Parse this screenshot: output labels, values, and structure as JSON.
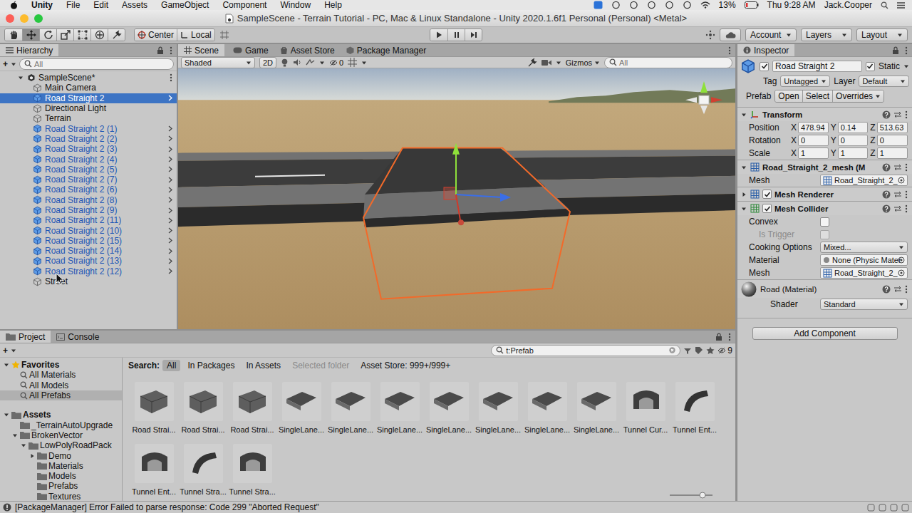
{
  "menubar": {
    "menus": [
      "Unity",
      "File",
      "Edit",
      "Assets",
      "GameObject",
      "Component",
      "Window",
      "Help"
    ],
    "battery": "13%",
    "clock": "Thu 9:28 AM",
    "user": "Jack.Cooper"
  },
  "window": {
    "title": "SampleScene - Terrain Tutorial - PC, Mac & Linux Standalone - Unity 2020.1.6f1 Personal (Personal) <Metal>"
  },
  "toolbar": {
    "tools": [
      {
        "selected": false
      },
      {
        "selected": true
      },
      {
        "selected": false
      },
      {
        "selected": false
      },
      {
        "selected": false
      },
      {
        "selected": false
      },
      {
        "selected": false
      }
    ],
    "pivot": "Center",
    "space": "Local",
    "account": "Account",
    "layers": "Layers",
    "layout": "Layout"
  },
  "hierarchy": {
    "title": "Hierarchy",
    "add": "+",
    "search": "All",
    "scene": "SampleScene*",
    "items": [
      {
        "label": "Main Camera",
        "kind": "object",
        "selected": false
      },
      {
        "label": "Road Straight 2",
        "kind": "prefab",
        "selected": true
      },
      {
        "label": "Directional Light",
        "kind": "object",
        "selected": false
      },
      {
        "label": "Terrain",
        "kind": "object",
        "selected": false
      },
      {
        "label": "Road Straight 2 (1)",
        "kind": "prefab",
        "selected": false
      },
      {
        "label": "Road Straight 2 (2)",
        "kind": "prefab",
        "selected": false
      },
      {
        "label": "Road Straight 2 (3)",
        "kind": "prefab",
        "selected": false
      },
      {
        "label": "Road Straight 2 (4)",
        "kind": "prefab",
        "selected": false
      },
      {
        "label": "Road Straight 2 (5)",
        "kind": "prefab",
        "selected": false
      },
      {
        "label": "Road Straight 2 (7)",
        "kind": "prefab",
        "selected": false
      },
      {
        "label": "Road Straight 2 (6)",
        "kind": "prefab",
        "selected": false
      },
      {
        "label": "Road Straight 2 (8)",
        "kind": "prefab",
        "selected": false
      },
      {
        "label": "Road Straight 2 (9)",
        "kind": "prefab",
        "selected": false
      },
      {
        "label": "Road Straight 2 (11)",
        "kind": "prefab",
        "selected": false
      },
      {
        "label": "Road Straight 2 (10)",
        "kind": "prefab",
        "selected": false
      },
      {
        "label": "Road Straight 2 (15)",
        "kind": "prefab",
        "selected": false
      },
      {
        "label": "Road Straight 2 (14)",
        "kind": "prefab",
        "selected": false
      },
      {
        "label": "Road Straight 2 (13)",
        "kind": "prefab",
        "selected": false
      },
      {
        "label": "Road Straight 2 (12)",
        "kind": "prefab",
        "selected": false
      },
      {
        "label": "Street",
        "kind": "object",
        "selected": false
      }
    ]
  },
  "scene_tabs": [
    {
      "label": "Scene",
      "selected": true
    },
    {
      "label": "Game",
      "selected": false
    },
    {
      "label": "Asset Store",
      "selected": false
    },
    {
      "label": "Package Manager",
      "selected": false
    }
  ],
  "scene_toolbar": {
    "shading": "Shaded",
    "mode": "2D",
    "hidden": "0",
    "gizmos": "Gizmos",
    "search": "All"
  },
  "inspector": {
    "title": "Inspector",
    "object": {
      "name": "Road Straight 2",
      "active": true,
      "static_label": "Static",
      "static": true,
      "tag_label": "Tag",
      "tag": "Untagged",
      "layer_label": "Layer",
      "layer": "Default",
      "prefab_label": "Prefab",
      "open": "Open",
      "select": "Select",
      "overrides": "Overrides"
    },
    "transform": {
      "title": "Transform",
      "expanded": true,
      "axes": [
        "X",
        "Y",
        "Z"
      ],
      "rows": [
        {
          "label": "Position",
          "x": "478.94",
          "y": "0.14",
          "z": "513.63"
        },
        {
          "label": "Rotation",
          "x": "0",
          "y": "0",
          "z": "0"
        },
        {
          "label": "Scale",
          "x": "1",
          "y": "1",
          "z": "1"
        }
      ]
    },
    "components": [
      {
        "kind": "plain",
        "expanded": true,
        "title": "Road_Straight_2_mesh (M",
        "fields": [
          {
            "kind": "object",
            "label": "Mesh",
            "value": "Road_Straight_2_"
          }
        ]
      },
      {
        "kind": "toggle",
        "expanded": false,
        "enabled": true,
        "title": "Mesh Renderer",
        "fields": []
      },
      {
        "kind": "toggle",
        "expanded": true,
        "enabled": true,
        "title": "Mesh Collider",
        "fields": [
          {
            "kind": "checkbox",
            "label": "Convex",
            "checked": false,
            "disabled": false
          },
          {
            "kind": "checkbox",
            "label": "Is Trigger",
            "checked": false,
            "disabled": true
          },
          {
            "kind": "dropdown",
            "label": "Cooking Options",
            "value": "Mixed..."
          },
          {
            "kind": "object",
            "label": "Material",
            "value": "None (Physic Mater"
          },
          {
            "kind": "object",
            "label": "Mesh",
            "value": "Road_Straight_2_"
          }
        ]
      }
    ],
    "material": {
      "name": "Road (Material)",
      "shader_label": "Shader",
      "shader": "Standard"
    },
    "add_component": "Add Component"
  },
  "project": {
    "tabs": [
      {
        "label": "Project",
        "selected": true
      },
      {
        "label": "Console",
        "selected": false
      }
    ],
    "add": "+",
    "search": "t:Prefab",
    "count": "9",
    "filter_label": "Search:",
    "filters": [
      {
        "label": "All",
        "selected": true,
        "disabled": false
      },
      {
        "label": "In Packages",
        "selected": false,
        "disabled": false
      },
      {
        "label": "In Assets",
        "selected": false,
        "disabled": false
      },
      {
        "label": "Selected folder",
        "selected": false,
        "disabled": true
      }
    ],
    "asset_store": "Asset Store: 999+/999+",
    "tree": [
      {
        "label": "Favorites",
        "kind": "favorites",
        "depth": 0,
        "arrow": "open",
        "selected": false
      },
      {
        "label": "All Materials",
        "kind": "search",
        "depth": 1,
        "arrow": "none",
        "selected": false
      },
      {
        "label": "All Models",
        "kind": "search",
        "depth": 1,
        "arrow": "none",
        "selected": false
      },
      {
        "label": "All Prefabs",
        "kind": "search",
        "depth": 1,
        "arrow": "none",
        "selected": true
      },
      {
        "label": "Assets",
        "kind": "root",
        "depth": 0,
        "arrow": "open",
        "selected": false
      },
      {
        "label": "_TerrainAutoUpgrade",
        "kind": "folder",
        "depth": 1,
        "arrow": "none",
        "selected": false
      },
      {
        "label": "BrokenVector",
        "kind": "folder",
        "depth": 1,
        "arrow": "open",
        "selected": false
      },
      {
        "label": "LowPolyRoadPack",
        "kind": "folder",
        "depth": 2,
        "arrow": "open",
        "selected": false
      },
      {
        "label": "Demo",
        "kind": "folder",
        "depth": 3,
        "arrow": "closed",
        "selected": false
      },
      {
        "label": "Materials",
        "kind": "folder",
        "depth": 3,
        "arrow": "none",
        "selected": false
      },
      {
        "label": "Models",
        "kind": "folder",
        "depth": 3,
        "arrow": "none",
        "selected": false
      },
      {
        "label": "Prefabs",
        "kind": "folder",
        "depth": 3,
        "arrow": "none",
        "selected": false
      },
      {
        "label": "Textures",
        "kind": "folder",
        "depth": 3,
        "arrow": "none",
        "selected": false
      }
    ],
    "assets": [
      "Road Strai...",
      "Road Strai...",
      "Road Strai...",
      "SingleLane...",
      "SingleLane...",
      "SingleLane...",
      "SingleLane...",
      "SingleLane...",
      "SingleLane...",
      "SingleLane...",
      "Tunnel Cur...",
      "Tunnel Ent...",
      "Tunnel Ent...",
      "Tunnel Stra...",
      "Tunnel Stra..."
    ]
  },
  "status_bar": {
    "message": "[PackageManager] Error Failed to parse response: Code 299 \"Aborted Request\""
  }
}
